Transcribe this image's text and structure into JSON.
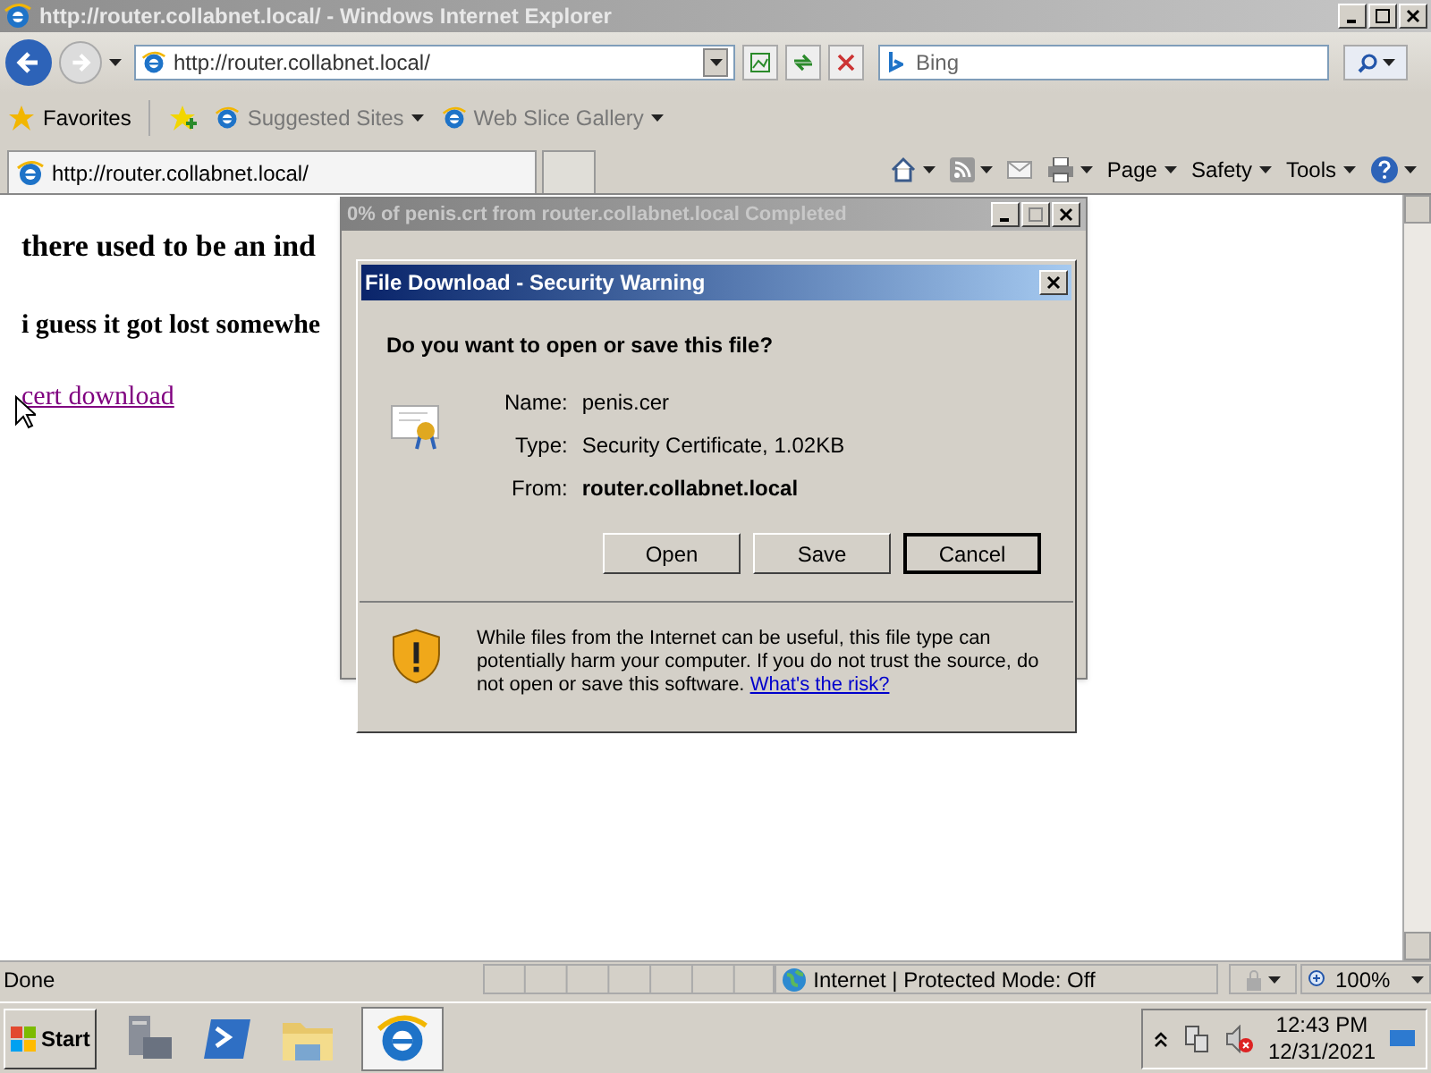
{
  "window": {
    "title": "http://router.collabnet.local/ - Windows Internet Explorer"
  },
  "address_bar": {
    "value": "http://router.collabnet.local/"
  },
  "search": {
    "placeholder": "Bing"
  },
  "favorites_bar": {
    "favorites": "Favorites",
    "links": [
      "Suggested Sites",
      "Web Slice Gallery"
    ]
  },
  "tab": {
    "title": "http://router.collabnet.local/",
    "selected": true
  },
  "command_bar": [
    "Page",
    "Safety",
    "Tools"
  ],
  "page": {
    "heading_1": "there used to be an ind",
    "heading_2": "i guess it got lost somewhe",
    "link": "cert download"
  },
  "progress_window": {
    "title": "0% of penis.crt from router.collabnet.local Completed"
  },
  "dialog": {
    "title": "File Download - Security Warning",
    "question": "Do you want to open or save this file?",
    "fields": [
      {
        "label": "Name:",
        "value": "penis.cer",
        "bold": false
      },
      {
        "label": "Type:",
        "value": "Security Certificate, 1.02KB",
        "bold": false
      },
      {
        "label": "From:",
        "value": "router.collabnet.local",
        "bold": true
      }
    ],
    "buttons": [
      {
        "label": "Open",
        "default": false
      },
      {
        "label": "Save",
        "default": false
      },
      {
        "label": "Cancel",
        "default": true
      }
    ],
    "warning": "While files from the Internet can be useful, this file type can potentially harm your computer. If you do not trust the source, do not open or save this software.",
    "warning_link": "What's the risk?"
  },
  "status_bar": {
    "status": "Done",
    "zone": "Internet | Protected Mode: Off",
    "zoom": "100%"
  },
  "taskbar": {
    "start": "Start",
    "time": "12:43 PM",
    "date": "12/31/2021"
  }
}
